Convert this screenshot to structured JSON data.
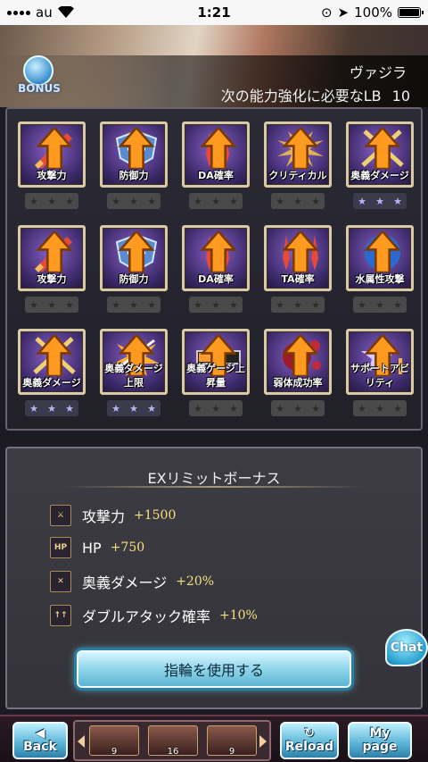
{
  "status_bar": {
    "carrier": "au",
    "time": "1:21",
    "battery": "100%"
  },
  "header": {
    "bonus_label": "BONUS",
    "character_name": "ヴァジラ",
    "lb_required_label": "次の能力強化に必要なLB",
    "lb_required_value": "10"
  },
  "skills": [
    {
      "label": "攻撃力",
      "icon": "sword-icon",
      "stars_active": false
    },
    {
      "label": "防御力",
      "icon": "shield-icon",
      "stars_active": false
    },
    {
      "label": "DA確率",
      "icon": "double-attack-icon",
      "stars_active": false
    },
    {
      "label": "クリティカル",
      "icon": "critical-icon",
      "stars_active": false
    },
    {
      "label": "奥義ダメージ",
      "icon": "crossed-swords-icon",
      "stars_active": true
    },
    {
      "label": "攻撃力",
      "icon": "sword-icon",
      "stars_active": false
    },
    {
      "label": "防御力",
      "icon": "shield-icon",
      "stars_active": false
    },
    {
      "label": "DA確率",
      "icon": "double-attack-icon",
      "stars_active": false
    },
    {
      "label": "TA確率",
      "icon": "triple-attack-icon",
      "stars_active": false
    },
    {
      "label": "水属性攻撃",
      "icon": "water-drop-icon",
      "stars_active": false
    },
    {
      "label": "奥義ダメージ",
      "icon": "crossed-swords-icon",
      "stars_active": true
    },
    {
      "label": "奥義ダメージ上限",
      "icon": "burst-icon",
      "stars_active": true
    },
    {
      "label": "奥義ゲージ上昇量",
      "icon": "gauge-icon",
      "stars_active": false
    },
    {
      "label": "弱体成功率",
      "icon": "debuff-icon",
      "stars_active": false
    },
    {
      "label": "サポートアビリティ",
      "icon": "star-plus-icon",
      "stars_active": false
    }
  ],
  "ex_limit": {
    "title": "EXリミットボーナス",
    "rows": [
      {
        "icon_text": "⚔",
        "name": "攻撃力",
        "value": "+1500"
      },
      {
        "icon_text": "HP",
        "name": "HP",
        "value": "+750"
      },
      {
        "icon_text": "✕",
        "name": "奥義ダメージ",
        "value": "+20%"
      },
      {
        "icon_text": "↑↑",
        "name": "ダブルアタック確率",
        "value": "+10%"
      }
    ]
  },
  "chat_label": "Chat",
  "ring_button_label": "指輪を使用する",
  "bottom_nav": {
    "back_icon": "◀",
    "back_label": "Back",
    "thumb_counts": [
      "9",
      "16",
      "9"
    ],
    "reload_label": "Reload",
    "mypage_label_1": "My",
    "mypage_label_2": "page"
  },
  "colors": {
    "frame_gold": "#d8c9a8",
    "accent_blue": "#58b2d4",
    "value_yellow": "#f5e27a"
  }
}
